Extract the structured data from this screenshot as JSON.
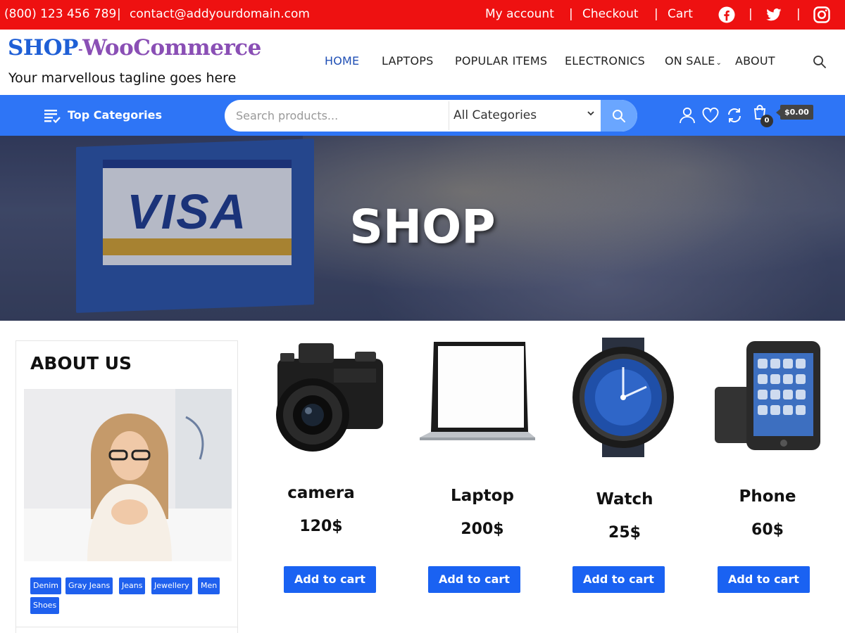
{
  "topbar": {
    "phone": "(800) 123 456 789",
    "email": "contact@addyourdomain.com",
    "links": [
      "My account",
      "Checkout",
      "Cart"
    ],
    "separator": "|",
    "social_icons": [
      "facebook-icon",
      "twitter-icon",
      "instagram-icon"
    ],
    "bg_color": "#ee1111"
  },
  "header": {
    "logo_part1": "SHOP",
    "logo_sep": "-",
    "logo_part2": "WooCommerce",
    "tagline": "Your marvellous tagline goes here",
    "nav": [
      {
        "label": "HOME",
        "active": true
      },
      {
        "label": "LAPTOPS"
      },
      {
        "label": "POPULAR ITEMS"
      },
      {
        "label": "ELECTRONICS"
      },
      {
        "label": "ON SALE",
        "has_dropdown": true
      },
      {
        "label": "ABOUT"
      }
    ],
    "dropdown_caret": "⌄",
    "search_icon": "search-icon"
  },
  "bar": {
    "top_categories": "Top Categories",
    "search_placeholder": "Search products...",
    "category_select": "All Categories",
    "cart_count": "0",
    "cart_total": "$0.00",
    "icons": [
      "user-icon",
      "heart-icon",
      "compare-icon",
      "cart-icon"
    ],
    "bg_color": "#2e75f6"
  },
  "hero": {
    "title": "SHOP",
    "card_text": "VISA"
  },
  "sidebar": {
    "title": "ABOUT US",
    "tags": [
      "Denim",
      "Gray Jeans",
      "Jeans",
      "Jewellery",
      "Men",
      "Shoes"
    ]
  },
  "products": [
    {
      "name": "camera",
      "price": "120$",
      "button": "Add to cart",
      "image": "camera-image"
    },
    {
      "name": "Laptop",
      "price": "200$",
      "button": "Add to cart",
      "image": "laptop-image"
    },
    {
      "name": "Watch",
      "price": "25$",
      "button": "Add to cart",
      "image": "watch-image"
    },
    {
      "name": "Phone",
      "price": "60$",
      "button": "Add to cart",
      "image": "phone-image"
    }
  ],
  "colors": {
    "button": "#1a62f2",
    "nav_active": "#1f4fb5"
  }
}
